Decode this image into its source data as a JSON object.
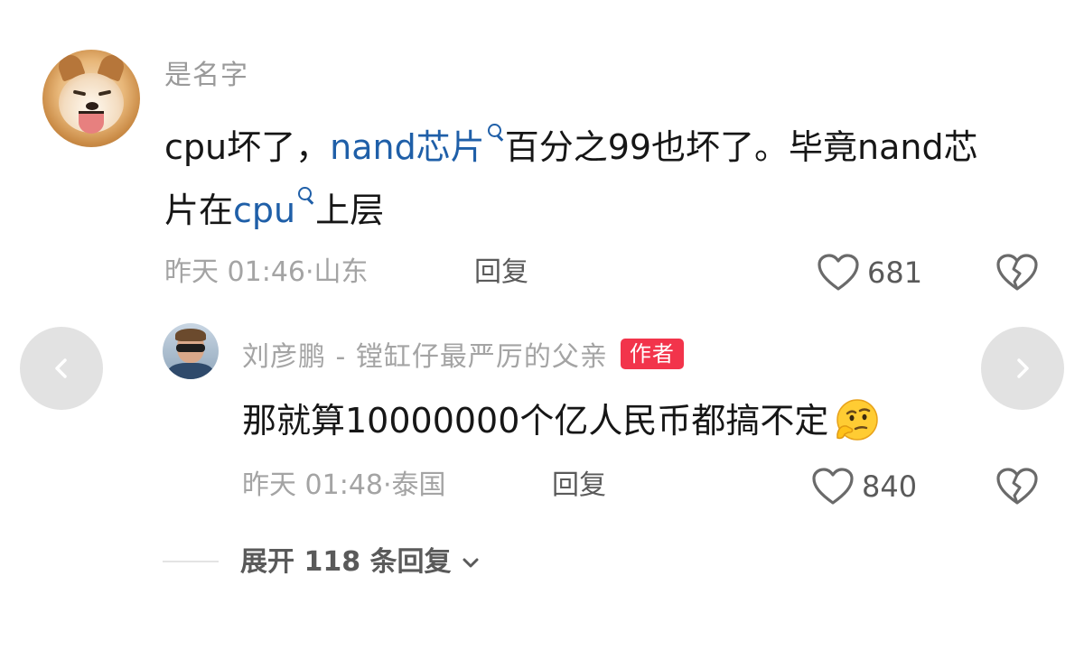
{
  "comment": {
    "username": "是名字",
    "text_parts": {
      "p1": "cpu坏了，",
      "kw1": "nand芯片",
      "p2": "百分之99也坏了。毕竟nand芯片在",
      "kw2": "cpu",
      "p3": "上层"
    },
    "time": "昨天 01:46",
    "location": "山东",
    "reply_label": "回复",
    "like_count": "681"
  },
  "reply": {
    "username": "刘彦鹏 - 镗缸仔最严厉的父亲",
    "author_badge": "作者",
    "text": "那就算10000000个亿人民币都搞不定",
    "time": "昨天 01:48",
    "location": "泰国",
    "reply_label": "回复",
    "like_count": "840"
  },
  "expand": {
    "label": "展开 118 条回复"
  },
  "icons": {
    "like": "heart-outline-icon",
    "dislike": "broken-heart-icon",
    "search": "search-icon",
    "prev": "chevron-left-icon",
    "next": "chevron-right-icon",
    "expand": "chevron-down-icon",
    "emoji": "thinking-emoji-icon"
  },
  "colors": {
    "keyword": "#1f5fa8",
    "author_badge_bg": "#f2344b",
    "secondary_text": "#a4a4a4",
    "primary_text": "#161616"
  }
}
